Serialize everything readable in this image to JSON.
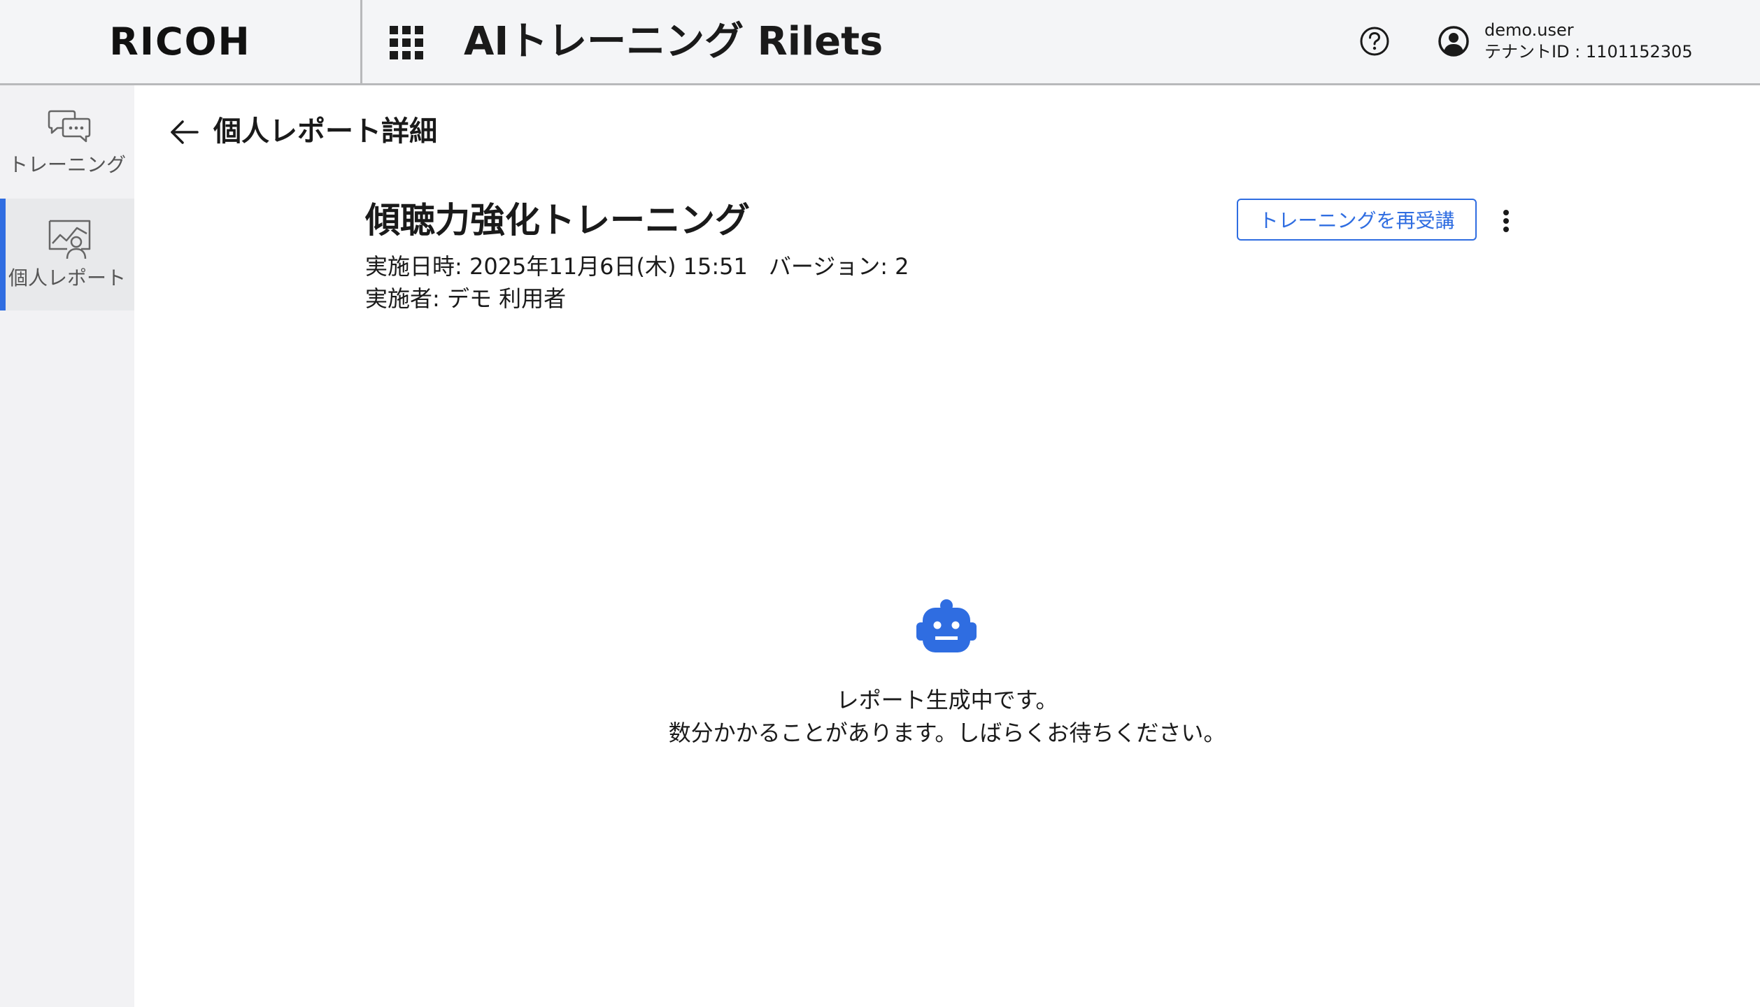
{
  "header": {
    "logo": "RICOH",
    "app_title": "AIトレーニング Rilets",
    "user": {
      "name": "demo.user",
      "tenant": "テナントID : 1101152305"
    }
  },
  "sidebar": {
    "items": [
      {
        "label": "トレーニング",
        "icon": "chat-bubbles-icon",
        "active": false
      },
      {
        "label": "個人レポート",
        "icon": "report-chart-person-icon",
        "active": true
      }
    ]
  },
  "main": {
    "page_title": "個人レポート詳細",
    "course_title": "傾聴力強化トレーニング",
    "date_text": "実施日時: 2025年11月6日(木) 15:51",
    "version_text": "バージョン: 2",
    "performer_text": "実施者: デモ 利用者",
    "retake_button": "トレーニングを再受講",
    "status_line1": "レポート生成中です。",
    "status_line2": "数分かかることがあります。しばらくお待ちください。"
  },
  "colors": {
    "accent": "#2f6de1",
    "header_bg": "#f4f5f7",
    "sidebar_bg": "#f2f2f4"
  }
}
